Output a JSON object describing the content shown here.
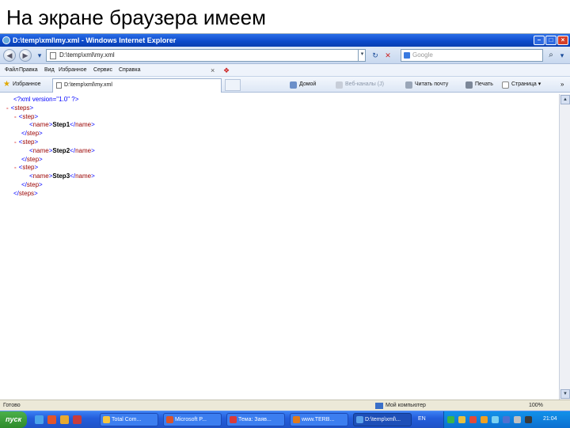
{
  "slide": {
    "title": "На экране браузера имеем"
  },
  "window": {
    "title": "D:\\temp\\xml\\my.xml - Windows Internet Explorer"
  },
  "address": {
    "url": "D:\\temp\\xml\\my.xml"
  },
  "search": {
    "placeholder": "Google"
  },
  "menu": {
    "items": [
      "Файл",
      "Правка",
      "Вид",
      "Избранное",
      "Сервис",
      "Справка"
    ]
  },
  "favorites": {
    "label": "Избранное",
    "tab_title": "D:\\temp\\xml\\my.xml"
  },
  "commandbar": {
    "home": "Домой",
    "feeds": "Веб-каналы (J)",
    "mail": "Читать почту",
    "print": "Печать",
    "page": "Страница"
  },
  "xml": {
    "lines": [
      {
        "indent": 0,
        "minus": false,
        "pi": "<?xml version=\"1.0\" ?>"
      },
      {
        "indent": 0,
        "minus": true,
        "open": "steps"
      },
      {
        "indent": 1,
        "minus": true,
        "open": "step"
      },
      {
        "indent": 2,
        "minus": false,
        "open": "name",
        "text": "Step1",
        "close": "name"
      },
      {
        "indent": 1,
        "minus": false,
        "close": "step"
      },
      {
        "indent": 1,
        "minus": true,
        "open": "step"
      },
      {
        "indent": 2,
        "minus": false,
        "open": "name",
        "text": "Step2",
        "close": "name"
      },
      {
        "indent": 1,
        "minus": false,
        "close": "step"
      },
      {
        "indent": 1,
        "minus": true,
        "open": "step"
      },
      {
        "indent": 2,
        "minus": false,
        "open": "name",
        "text": "Step3",
        "close": "name"
      },
      {
        "indent": 1,
        "minus": false,
        "close": "step"
      },
      {
        "indent": 0,
        "minus": false,
        "close": "steps"
      }
    ]
  },
  "status": {
    "left": "Готово",
    "zone": "Мой компьютер",
    "zoom": "100%"
  },
  "taskbar": {
    "start": "пуск",
    "buttons": [
      {
        "label": "Total Com...",
        "color": "#f4c542",
        "active": false
      },
      {
        "label": "Microsoft P...",
        "color": "#d9532b",
        "active": false
      },
      {
        "label": "Тема: Заяв...",
        "color": "#d83a3a",
        "active": false
      },
      {
        "label": "www.TERB...",
        "color": "#e07a1c",
        "active": false
      },
      {
        "label": "D:\\temp\\xml\\...",
        "color": "#5aa0ea",
        "active": true
      }
    ],
    "lang": "EN",
    "clock": "21:04"
  },
  "colors": {
    "tag": "#990000",
    "bracket": "#0000ff",
    "minus": "#dd4444"
  }
}
